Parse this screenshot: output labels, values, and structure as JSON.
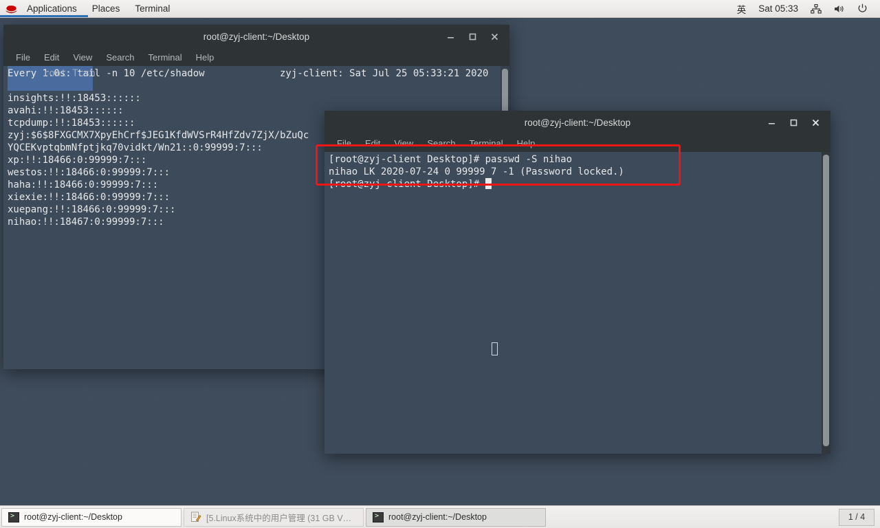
{
  "top_panel": {
    "logo_icon": "redhat-logo-icon",
    "menus": [
      "Applications",
      "Places",
      "Terminal"
    ],
    "status": {
      "input_method": "英",
      "clock": "Sat 05:33",
      "network_icon": "network-icon",
      "volume_icon": "volume-icon",
      "power_icon": "power-icon"
    }
  },
  "window1": {
    "title": "root@zyj-client:~/Desktop",
    "menus": [
      "File",
      "Edit",
      "View",
      "Search",
      "Terminal",
      "Help"
    ],
    "controls": {
      "minimize": "_",
      "maximize": "□",
      "close": "✕"
    },
    "watch_header_left": "Every 1.0s: tail -n 10 /etc/shadow",
    "watch_header_ghost": "root Tcsh",
    "watch_header_right": "zyj-client: Sat Jul 25 05:33:21 2020",
    "lines": [
      "insights:!!:18453::::::",
      "avahi:!!:18453::::::",
      "tcpdump:!!:18453::::::",
      "zyj:$6$8FXGCMX7XpyEhCrf$JEG1KfdWVSrR4HfZdv7ZjX/bZuQc",
      "YQCEKvptqbmNfptjkq70vidkt/Wn21::0:99999:7:::",
      "xp:!!:18466:0:99999:7:::",
      "westos:!!:18466:0:99999:7:::",
      "haha:!!:18466:0:99999:7:::",
      "xiexie:!!:18466:0:99999:7:::",
      "xuepang:!!:18466:0:99999:7:::",
      "nihao:!!:18467:0:99999:7:::"
    ]
  },
  "window2": {
    "title": "root@zyj-client:~/Desktop",
    "menus": [
      "File",
      "Edit",
      "View",
      "Search",
      "Terminal",
      "Help"
    ],
    "controls": {
      "minimize": "_",
      "maximize": "□",
      "close": "✕"
    },
    "lines": [
      "[root@zyj-client Desktop]# passwd -S nihao",
      "nihao LK 2020-07-24 0 99999 7 -1 (Password locked.)",
      "[root@zyj-client Desktop]# "
    ]
  },
  "annotation": {
    "color": "#f01616",
    "shape": "rectangle"
  },
  "taskbar": {
    "tasks": [
      {
        "label": "root@zyj-client:~/Desktop",
        "icon": "terminal-icon",
        "state": "normal"
      },
      {
        "label": "[5.Linux系统中的用户管理 (31 GB V…",
        "icon": "document-icon",
        "state": "minimized"
      },
      {
        "label": "root@zyj-client:~/Desktop",
        "icon": "terminal-icon",
        "state": "active"
      }
    ],
    "workspace": "1 / 4"
  }
}
